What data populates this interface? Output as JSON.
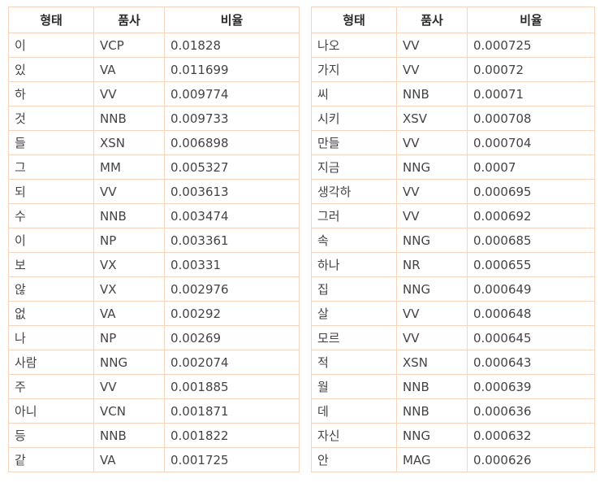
{
  "tables": [
    {
      "headers": [
        "형태",
        "품사",
        "비율"
      ],
      "rows": [
        [
          "이",
          "VCP",
          "0.01828"
        ],
        [
          "있",
          "VA",
          "0.011699"
        ],
        [
          "하",
          "VV",
          "0.009774"
        ],
        [
          "것",
          "NNB",
          "0.009733"
        ],
        [
          "들",
          "XSN",
          "0.006898"
        ],
        [
          "그",
          "MM",
          "0.005327"
        ],
        [
          "되",
          "VV",
          "0.003613"
        ],
        [
          "수",
          "NNB",
          "0.003474"
        ],
        [
          "이",
          "NP",
          "0.003361"
        ],
        [
          "보",
          "VX",
          "0.00331"
        ],
        [
          "않",
          "VX",
          "0.002976"
        ],
        [
          "없",
          "VA",
          "0.00292"
        ],
        [
          "나",
          "NP",
          "0.00269"
        ],
        [
          "사람",
          "NNG",
          "0.002074"
        ],
        [
          "주",
          "VV",
          "0.001885"
        ],
        [
          "아니",
          "VCN",
          "0.001871"
        ],
        [
          "등",
          "NNB",
          "0.001822"
        ],
        [
          "같",
          "VA",
          "0.001725"
        ]
      ]
    },
    {
      "headers": [
        "형태",
        "품사",
        "비율"
      ],
      "rows": [
        [
          "나오",
          "VV",
          "0.000725"
        ],
        [
          "가지",
          "VV",
          "0.00072"
        ],
        [
          "씨",
          "NNB",
          "0.00071"
        ],
        [
          "시키",
          "XSV",
          "0.000708"
        ],
        [
          "만들",
          "VV",
          "0.000704"
        ],
        [
          "지금",
          "NNG",
          "0.0007"
        ],
        [
          "생각하",
          "VV",
          "0.000695"
        ],
        [
          "그러",
          "VV",
          "0.000692"
        ],
        [
          "속",
          "NNG",
          "0.000685"
        ],
        [
          "하나",
          "NR",
          "0.000655"
        ],
        [
          "집",
          "NNG",
          "0.000649"
        ],
        [
          "살",
          "VV",
          "0.000648"
        ],
        [
          "모르",
          "VV",
          "0.000645"
        ],
        [
          "적",
          "XSN",
          "0.000643"
        ],
        [
          "월",
          "NNB",
          "0.000639"
        ],
        [
          "데",
          "NNB",
          "0.000636"
        ],
        [
          "자신",
          "NNG",
          "0.000632"
        ],
        [
          "안",
          "MAG",
          "0.000626"
        ]
      ]
    }
  ],
  "colors": {
    "border": "#f6d5bf",
    "text": "#444444"
  }
}
